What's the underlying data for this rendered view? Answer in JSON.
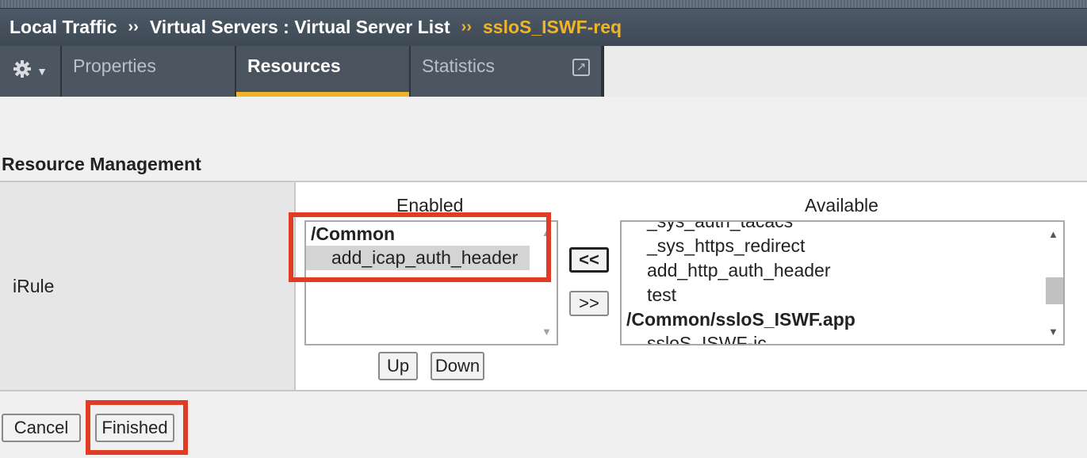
{
  "breadcrumb": {
    "part1": "Local Traffic",
    "part2": "Virtual Servers : Virtual Server List",
    "current": "ssloS_ISWF-req",
    "separator": "››"
  },
  "tabs": {
    "gear_icon": "gear-icon",
    "properties": "Properties",
    "resources": "Resources",
    "statistics": "Statistics"
  },
  "section_title": "Resource Management",
  "irule": {
    "label": "iRule",
    "enabled_header": "Enabled",
    "available_header": "Available",
    "enabled_list": {
      "group": "/Common",
      "items": [
        "add_icap_auth_header"
      ]
    },
    "available_list": {
      "partial_top": "_sys_auth_tacacs",
      "items": [
        "_sys_https_redirect",
        "add_http_auth_header",
        "test"
      ],
      "group": "/Common/ssloS_ISWF.app",
      "partial_bottom": "ssloS_ISWF-ic"
    },
    "move_left_label": "<<",
    "move_right_label": ">>",
    "up_label": "Up",
    "down_label": "Down"
  },
  "footer": {
    "cancel_label": "Cancel",
    "finished_label": "Finished"
  },
  "colors": {
    "accent": "#f0b428",
    "highlight": "#e03b25",
    "header_bg": "#4d5966"
  }
}
